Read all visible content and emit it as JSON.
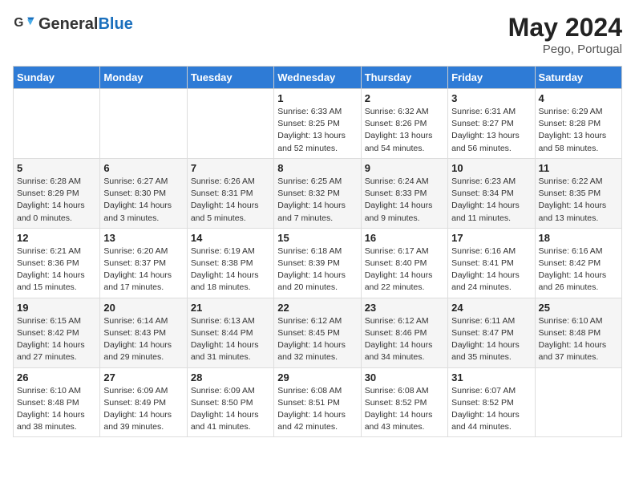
{
  "header": {
    "logo_general": "General",
    "logo_blue": "Blue",
    "month_year": "May 2024",
    "location": "Pego, Portugal"
  },
  "weekdays": [
    "Sunday",
    "Monday",
    "Tuesday",
    "Wednesday",
    "Thursday",
    "Friday",
    "Saturday"
  ],
  "weeks": [
    [
      {
        "day": "",
        "info": ""
      },
      {
        "day": "",
        "info": ""
      },
      {
        "day": "",
        "info": ""
      },
      {
        "day": "1",
        "info": "Sunrise: 6:33 AM\nSunset: 8:25 PM\nDaylight: 13 hours\nand 52 minutes."
      },
      {
        "day": "2",
        "info": "Sunrise: 6:32 AM\nSunset: 8:26 PM\nDaylight: 13 hours\nand 54 minutes."
      },
      {
        "day": "3",
        "info": "Sunrise: 6:31 AM\nSunset: 8:27 PM\nDaylight: 13 hours\nand 56 minutes."
      },
      {
        "day": "4",
        "info": "Sunrise: 6:29 AM\nSunset: 8:28 PM\nDaylight: 13 hours\nand 58 minutes."
      }
    ],
    [
      {
        "day": "5",
        "info": "Sunrise: 6:28 AM\nSunset: 8:29 PM\nDaylight: 14 hours\nand 0 minutes."
      },
      {
        "day": "6",
        "info": "Sunrise: 6:27 AM\nSunset: 8:30 PM\nDaylight: 14 hours\nand 3 minutes."
      },
      {
        "day": "7",
        "info": "Sunrise: 6:26 AM\nSunset: 8:31 PM\nDaylight: 14 hours\nand 5 minutes."
      },
      {
        "day": "8",
        "info": "Sunrise: 6:25 AM\nSunset: 8:32 PM\nDaylight: 14 hours\nand 7 minutes."
      },
      {
        "day": "9",
        "info": "Sunrise: 6:24 AM\nSunset: 8:33 PM\nDaylight: 14 hours\nand 9 minutes."
      },
      {
        "day": "10",
        "info": "Sunrise: 6:23 AM\nSunset: 8:34 PM\nDaylight: 14 hours\nand 11 minutes."
      },
      {
        "day": "11",
        "info": "Sunrise: 6:22 AM\nSunset: 8:35 PM\nDaylight: 14 hours\nand 13 minutes."
      }
    ],
    [
      {
        "day": "12",
        "info": "Sunrise: 6:21 AM\nSunset: 8:36 PM\nDaylight: 14 hours\nand 15 minutes."
      },
      {
        "day": "13",
        "info": "Sunrise: 6:20 AM\nSunset: 8:37 PM\nDaylight: 14 hours\nand 17 minutes."
      },
      {
        "day": "14",
        "info": "Sunrise: 6:19 AM\nSunset: 8:38 PM\nDaylight: 14 hours\nand 18 minutes."
      },
      {
        "day": "15",
        "info": "Sunrise: 6:18 AM\nSunset: 8:39 PM\nDaylight: 14 hours\nand 20 minutes."
      },
      {
        "day": "16",
        "info": "Sunrise: 6:17 AM\nSunset: 8:40 PM\nDaylight: 14 hours\nand 22 minutes."
      },
      {
        "day": "17",
        "info": "Sunrise: 6:16 AM\nSunset: 8:41 PM\nDaylight: 14 hours\nand 24 minutes."
      },
      {
        "day": "18",
        "info": "Sunrise: 6:16 AM\nSunset: 8:42 PM\nDaylight: 14 hours\nand 26 minutes."
      }
    ],
    [
      {
        "day": "19",
        "info": "Sunrise: 6:15 AM\nSunset: 8:42 PM\nDaylight: 14 hours\nand 27 minutes."
      },
      {
        "day": "20",
        "info": "Sunrise: 6:14 AM\nSunset: 8:43 PM\nDaylight: 14 hours\nand 29 minutes."
      },
      {
        "day": "21",
        "info": "Sunrise: 6:13 AM\nSunset: 8:44 PM\nDaylight: 14 hours\nand 31 minutes."
      },
      {
        "day": "22",
        "info": "Sunrise: 6:12 AM\nSunset: 8:45 PM\nDaylight: 14 hours\nand 32 minutes."
      },
      {
        "day": "23",
        "info": "Sunrise: 6:12 AM\nSunset: 8:46 PM\nDaylight: 14 hours\nand 34 minutes."
      },
      {
        "day": "24",
        "info": "Sunrise: 6:11 AM\nSunset: 8:47 PM\nDaylight: 14 hours\nand 35 minutes."
      },
      {
        "day": "25",
        "info": "Sunrise: 6:10 AM\nSunset: 8:48 PM\nDaylight: 14 hours\nand 37 minutes."
      }
    ],
    [
      {
        "day": "26",
        "info": "Sunrise: 6:10 AM\nSunset: 8:48 PM\nDaylight: 14 hours\nand 38 minutes."
      },
      {
        "day": "27",
        "info": "Sunrise: 6:09 AM\nSunset: 8:49 PM\nDaylight: 14 hours\nand 39 minutes."
      },
      {
        "day": "28",
        "info": "Sunrise: 6:09 AM\nSunset: 8:50 PM\nDaylight: 14 hours\nand 41 minutes."
      },
      {
        "day": "29",
        "info": "Sunrise: 6:08 AM\nSunset: 8:51 PM\nDaylight: 14 hours\nand 42 minutes."
      },
      {
        "day": "30",
        "info": "Sunrise: 6:08 AM\nSunset: 8:52 PM\nDaylight: 14 hours\nand 43 minutes."
      },
      {
        "day": "31",
        "info": "Sunrise: 6:07 AM\nSunset: 8:52 PM\nDaylight: 14 hours\nand 44 minutes."
      },
      {
        "day": "",
        "info": ""
      }
    ]
  ]
}
